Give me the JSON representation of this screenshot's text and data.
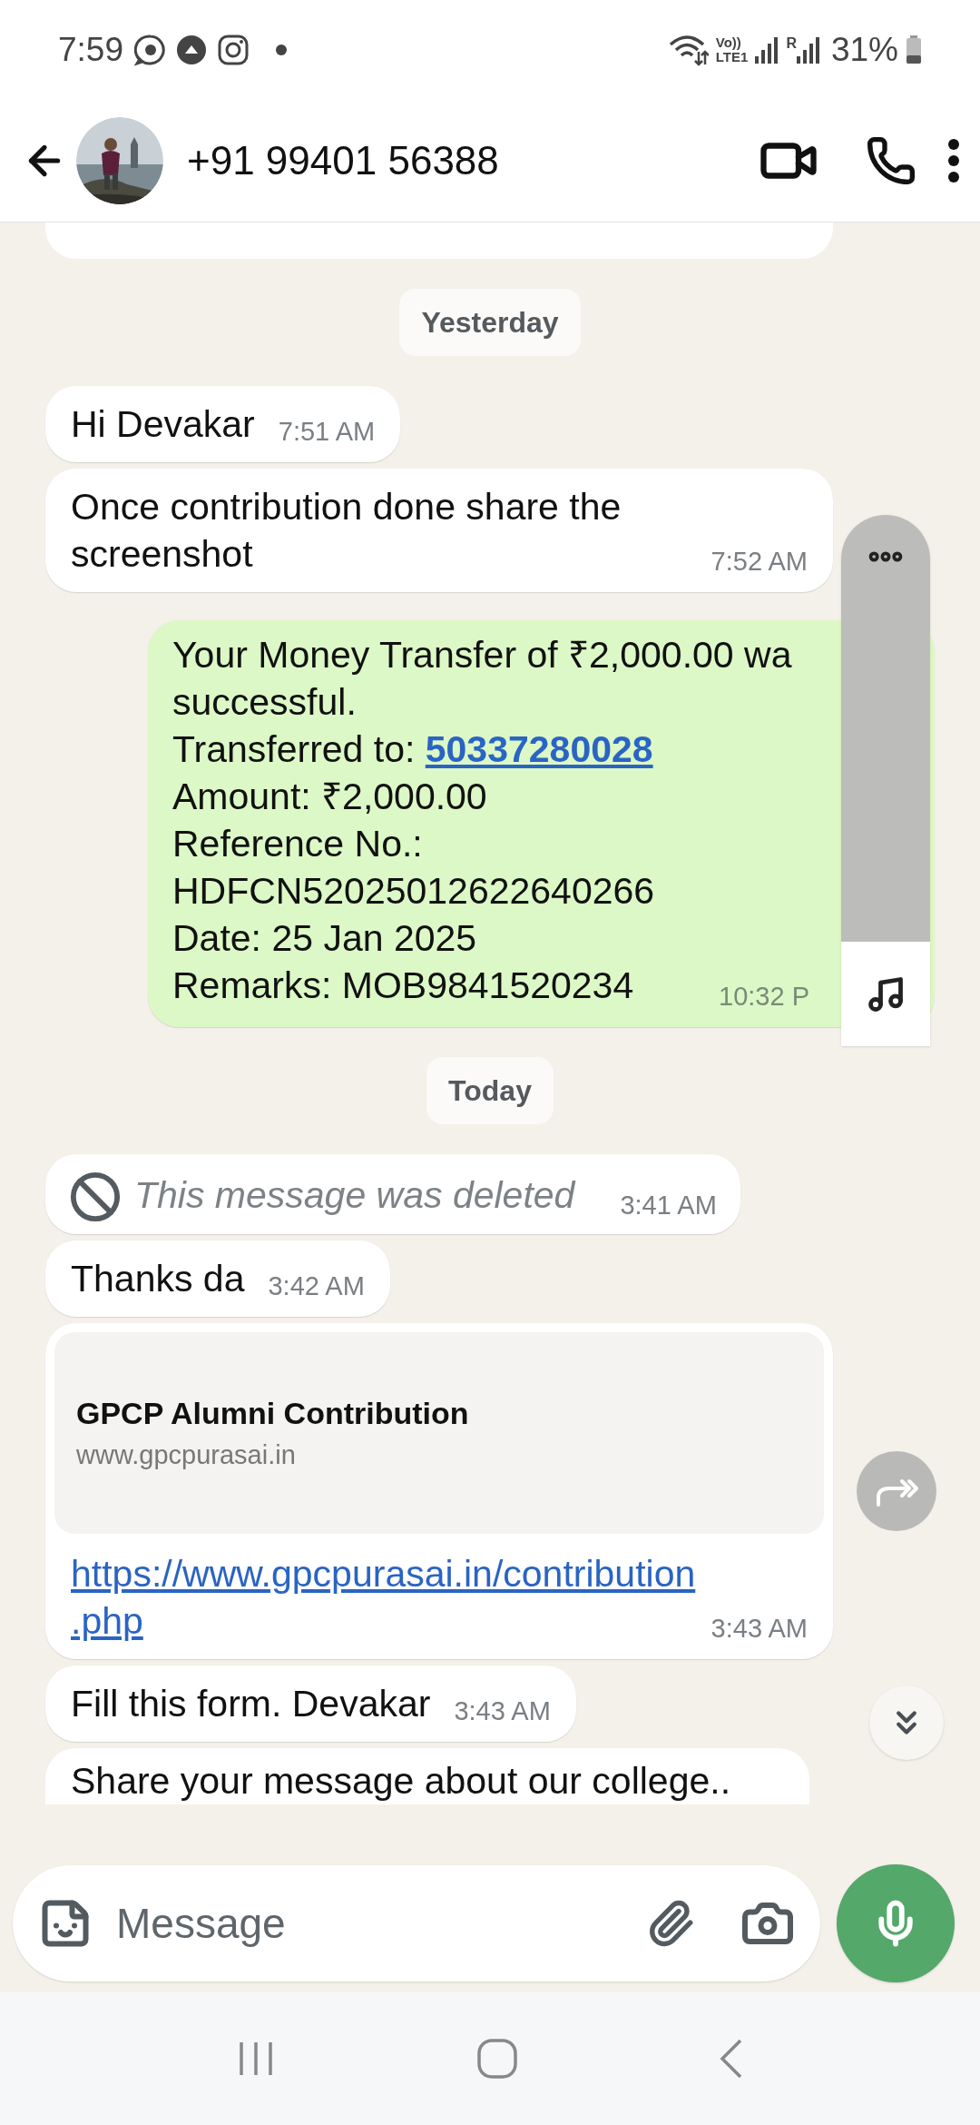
{
  "status_bar": {
    "time": "7:59",
    "volte_top": "Vo))",
    "volte_bottom": "LTE1",
    "roaming": "R",
    "battery": "31%"
  },
  "header": {
    "title": "+91 99401 56388"
  },
  "messages": [
    {
      "kind": "partial"
    },
    {
      "kind": "date",
      "text": "Yesterday"
    },
    {
      "kind": "text",
      "text": "Hi Devakar",
      "time": "7:51 AM"
    },
    {
      "kind": "text",
      "text": "Once contribution done share the screenshot",
      "time": "7:52 AM"
    },
    {
      "kind": "transfer",
      "lines": [
        {
          "text": "Your Money Transfer of ₹2,000.00 wa"
        },
        {
          "text": "successful."
        },
        {
          "text": "Transferred to: ",
          "link": "50337280028"
        },
        {
          "text": "Amount: ₹2,000.00"
        },
        {
          "text": "Reference No.:"
        },
        {
          "text": "HDFCN52025012622640266"
        },
        {
          "text": "Date: 25 Jan 2025"
        },
        {
          "text": "Remarks: MOB9841520234"
        }
      ],
      "time": "10:32 P"
    },
    {
      "kind": "date",
      "text": "Today"
    },
    {
      "kind": "deleted",
      "text": "This message was deleted",
      "time": "3:41 AM"
    },
    {
      "kind": "text",
      "text": "Thanks da",
      "time": "3:42 AM"
    },
    {
      "kind": "link",
      "preview_title": "GPCP Alumni Contribution",
      "preview_domain": "www.gpcpurasai.in",
      "url_lines": [
        "https://www.gpcpurasai.in/contribution",
        ".php"
      ],
      "time": "3:43 AM"
    },
    {
      "kind": "text",
      "text": "Fill this form. Devakar",
      "time": "3:43 AM"
    },
    {
      "kind": "cut_text",
      "text": "Share your message about our college.."
    }
  ],
  "composer": {
    "placeholder": "Message"
  }
}
